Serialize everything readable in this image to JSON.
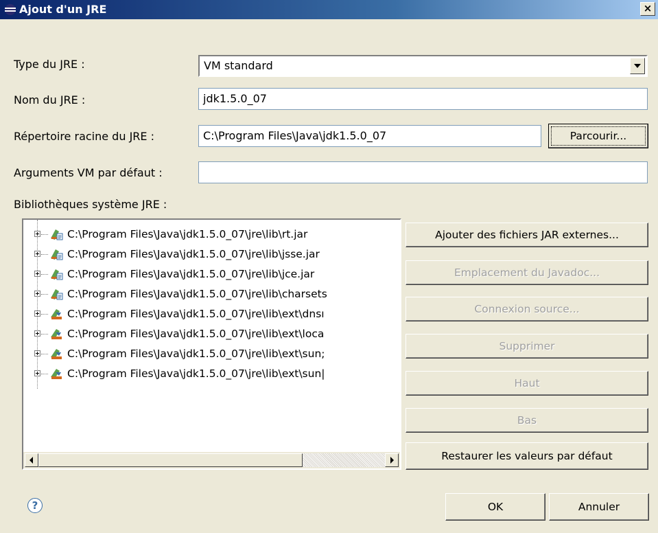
{
  "window": {
    "title": "Ajout d'un JRE",
    "close_glyph": "×"
  },
  "form": {
    "type_label": "Type du JRE :",
    "type_value": "VM standard",
    "name_label": "Nom du JRE :",
    "name_value": "jdk1.5.0_07",
    "home_label": "Répertoire racine du JRE :",
    "home_value": "C:\\Program Files\\Java\\jdk1.5.0_07",
    "browse_label": "Parcourir...",
    "vmargs_label": "Arguments VM par défaut :",
    "vmargs_value": "",
    "libs_label": "Bibliothèques système JRE :"
  },
  "libraries": [
    {
      "path": "C:\\Program Files\\Java\\jdk1.5.0_07\\jre\\lib\\rt.jar",
      "icon": "jar-with-source-icon"
    },
    {
      "path": "C:\\Program Files\\Java\\jdk1.5.0_07\\jre\\lib\\jsse.jar",
      "icon": "jar-with-source-icon"
    },
    {
      "path": "C:\\Program Files\\Java\\jdk1.5.0_07\\jre\\lib\\jce.jar",
      "icon": "jar-with-source-icon"
    },
    {
      "path": "C:\\Program Files\\Java\\jdk1.5.0_07\\jre\\lib\\charsets",
      "icon": "jar-with-source-icon"
    },
    {
      "path": "C:\\Program Files\\Java\\jdk1.5.0_07\\jre\\lib\\ext\\dnsı",
      "icon": "jar-icon"
    },
    {
      "path": "C:\\Program Files\\Java\\jdk1.5.0_07\\jre\\lib\\ext\\loca",
      "icon": "jar-icon"
    },
    {
      "path": "C:\\Program Files\\Java\\jdk1.5.0_07\\jre\\lib\\ext\\sun;",
      "icon": "jar-icon"
    },
    {
      "path": "C:\\Program Files\\Java\\jdk1.5.0_07\\jre\\lib\\ext\\sun|",
      "icon": "jar-icon"
    }
  ],
  "side_buttons": {
    "add_external": "Ajouter des fichiers JAR externes...",
    "javadoc": "Emplacement du Javadoc...",
    "source": "Connexion source...",
    "remove": "Supprimer",
    "up": "Haut",
    "down": "Bas",
    "restore": "Restaurer les valeurs par défaut"
  },
  "footer": {
    "ok": "OK",
    "cancel": "Annuler",
    "help_glyph": "?"
  },
  "colors": {
    "title_start": "#0a246a",
    "title_end": "#a6caf0",
    "dialog_bg": "#ece9d8",
    "disabled_text": "#a0a0a0"
  }
}
